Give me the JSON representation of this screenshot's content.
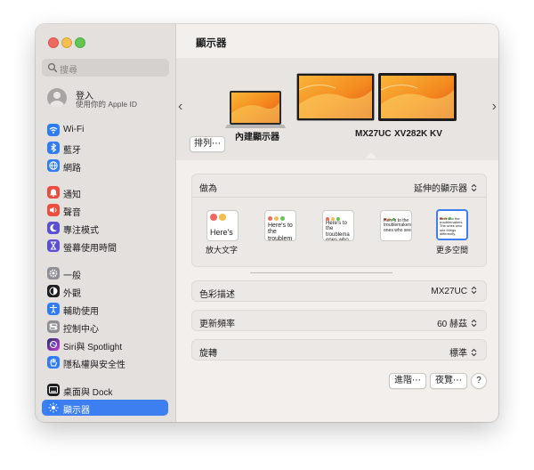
{
  "window": {
    "title": "顯示器"
  },
  "sidebar": {
    "search_placeholder": "搜尋",
    "account": {
      "name": "登入",
      "subtitle": "使用你的 Apple ID"
    },
    "items": [
      {
        "label": "Wi-Fi",
        "icon": "wifi-icon",
        "color": "#2f7cf6"
      },
      {
        "label": "藍牙",
        "icon": "bluetooth-icon",
        "color": "#2f7cf6"
      },
      {
        "label": "網路",
        "icon": "globe-icon",
        "color": "#2f7cf6"
      },
      {
        "label": "通知",
        "icon": "bell-icon",
        "color": "#ef4b3f"
      },
      {
        "label": "聲音",
        "icon": "speaker-icon",
        "color": "#ef4b3f"
      },
      {
        "label": "專注模式",
        "icon": "moon-icon",
        "color": "#5a4fd6"
      },
      {
        "label": "螢幕使用時間",
        "icon": "hourglass-icon",
        "color": "#5a4fd6"
      },
      {
        "label": "一般",
        "icon": "gear-icon",
        "color": "#8e8e93"
      },
      {
        "label": "外觀",
        "icon": "appearance-icon",
        "color": "#1d1d1f"
      },
      {
        "label": "輔助使用",
        "icon": "accessibility-icon",
        "color": "#2f7cf6"
      },
      {
        "label": "控制中心",
        "icon": "control-center-icon",
        "color": "#8e8e93"
      },
      {
        "label": "Siri與 Spotlight",
        "icon": "siri-icon",
        "color": "#8b3fd6"
      },
      {
        "label": "隱私權與安全性",
        "icon": "hand-icon",
        "color": "#2f7cf6"
      },
      {
        "label": "桌面與 Dock",
        "icon": "dock-icon",
        "color": "#1d1d1f"
      },
      {
        "label": "顯示器",
        "icon": "brightness-icon",
        "color": "#2f7cf6",
        "selected": true
      }
    ]
  },
  "arrangement": {
    "arrange_button": "排列⋯",
    "displays": [
      {
        "name": "內建顯示器"
      },
      {
        "name": "MX27UC"
      },
      {
        "name": "XV282K KV"
      }
    ]
  },
  "use_as": {
    "label": "做為",
    "value": "延伸的顯示器",
    "scale_options": [
      {
        "text": "Here's"
      },
      {
        "text": "Here's to the troublem"
      },
      {
        "text": "Here's to the troublema ones who"
      },
      {
        "text": "Here's to the troublemakers ones who see"
      },
      {
        "text": "Here's to the troublemakers. The ones who see things differently."
      }
    ],
    "larger_text_label": "放大文字",
    "more_space_label": "更多空間"
  },
  "color_profile": {
    "label": "色彩描述",
    "value": "MX27UC"
  },
  "refresh_rate": {
    "label": "更新頻率",
    "value": "60 赫茲"
  },
  "rotation": {
    "label": "旋轉",
    "value": "標準"
  },
  "buttons": {
    "advanced": "進階⋯",
    "night_shift": "夜覽⋯",
    "help": "?"
  }
}
